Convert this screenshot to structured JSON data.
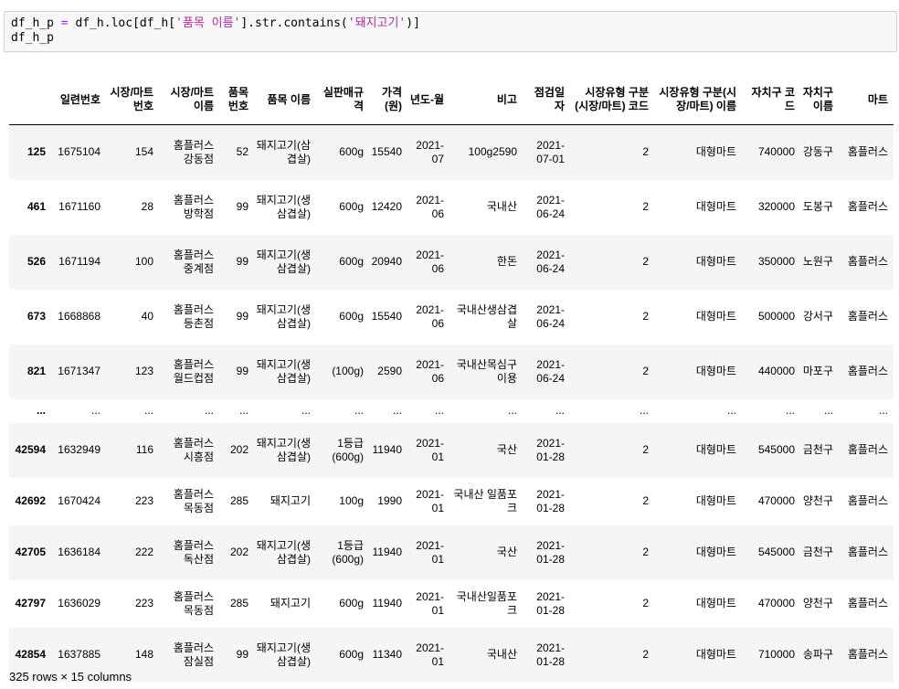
{
  "code": {
    "line1_prefix": "df_h_p ",
    "line1_eq": "=",
    "line1_mid": " df_h.loc[df_h[",
    "line1_str1": "'품목 이름'",
    "line1_mid2": "].str.contains(",
    "line1_str2": "'돼지고기'",
    "line1_end": ")]",
    "line2": "df_h_p"
  },
  "table": {
    "columns": [
      "",
      "일련번호",
      "시장/마트 번호",
      "시장/마트 이름",
      "품목 번호",
      "품목 이름",
      "실판매규격",
      "가격(원)",
      "년도-월",
      "비고",
      "점검일자",
      "시장유형 구분(시장/마트) 코드",
      "시장유형 구분(시장/마트) 이름",
      "자치구 코드",
      "자치구 이름",
      "마트"
    ],
    "rows": [
      [
        "125",
        "1675104",
        "154",
        "홈플러스 강동점",
        "52",
        "돼지고기(삼겹살)",
        "600g",
        "15540",
        "2021-07",
        "100g2590",
        "2021-07-01",
        "2",
        "대형마트",
        "740000",
        "강동구",
        "홈플러스"
      ],
      [
        "461",
        "1671160",
        "28",
        "홈플러스 방학점",
        "99",
        "돼지고기(생삼겹살)",
        "600g",
        "12420",
        "2021-06",
        "국내산",
        "2021-06-24",
        "2",
        "대형마트",
        "320000",
        "도봉구",
        "홈플러스"
      ],
      [
        "526",
        "1671194",
        "100",
        "홈플러스 중계점",
        "99",
        "돼지고기(생삼겹살)",
        "600g",
        "20940",
        "2021-06",
        "한돈",
        "2021-06-24",
        "2",
        "대형마트",
        "350000",
        "노원구",
        "홈플러스"
      ],
      [
        "673",
        "1668868",
        "40",
        "홈플러스 등촌점",
        "99",
        "돼지고기(생삼겹살)",
        "600g",
        "15540",
        "2021-06",
        "국내산생삼겹살",
        "2021-06-24",
        "2",
        "대형마트",
        "500000",
        "강서구",
        "홈플러스"
      ],
      [
        "821",
        "1671347",
        "123",
        "홈플러스 월드컵점",
        "99",
        "돼지고기(생삼겹살)",
        "(100g)",
        "2590",
        "2021-06",
        "국내산목심구이용",
        "2021-06-24",
        "2",
        "대형마트",
        "440000",
        "마포구",
        "홈플러스"
      ],
      [
        "...",
        "...",
        "...",
        "...",
        "...",
        "...",
        "...",
        "...",
        "...",
        "...",
        "...",
        "...",
        "...",
        "...",
        "...",
        "..."
      ],
      [
        "42594",
        "1632949",
        "116",
        "홈플러스 시흥점",
        "202",
        "돼지고기(생삼겹살)",
        "1등급(600g)",
        "11940",
        "2021-01",
        "국산",
        "2021-01-28",
        "2",
        "대형마트",
        "545000",
        "금천구",
        "홈플러스"
      ],
      [
        "42692",
        "1670424",
        "223",
        "홈플러스 목동점",
        "285",
        "돼지고기",
        "100g",
        "1990",
        "2021-01",
        "국내산 일품포크",
        "2021-01-28",
        "2",
        "대형마트",
        "470000",
        "양천구",
        "홈플러스"
      ],
      [
        "42705",
        "1636184",
        "222",
        "홈플러스 독산점",
        "202",
        "돼지고기(생삼겹살)",
        "1등급(600g)",
        "11940",
        "2021-01",
        "국산",
        "2021-01-28",
        "2",
        "대형마트",
        "545000",
        "금천구",
        "홈플러스"
      ],
      [
        "42797",
        "1636029",
        "223",
        "홈플러스 목동점",
        "285",
        "돼지고기",
        "600g",
        "11940",
        "2021-01",
        "국내산일품포크",
        "2021-01-28",
        "2",
        "대형마트",
        "470000",
        "양천구",
        "홈플러스"
      ],
      [
        "42854",
        "1637885",
        "148",
        "홈플러스 잠실점",
        "99",
        "돼지고기(생삼겹살)",
        "600g",
        "11340",
        "2021-01",
        "국내산",
        "2021-01-28",
        "2",
        "대형마트",
        "710000",
        "송파구",
        "홈플러스"
      ]
    ]
  },
  "footer": "325 rows × 15 columns"
}
